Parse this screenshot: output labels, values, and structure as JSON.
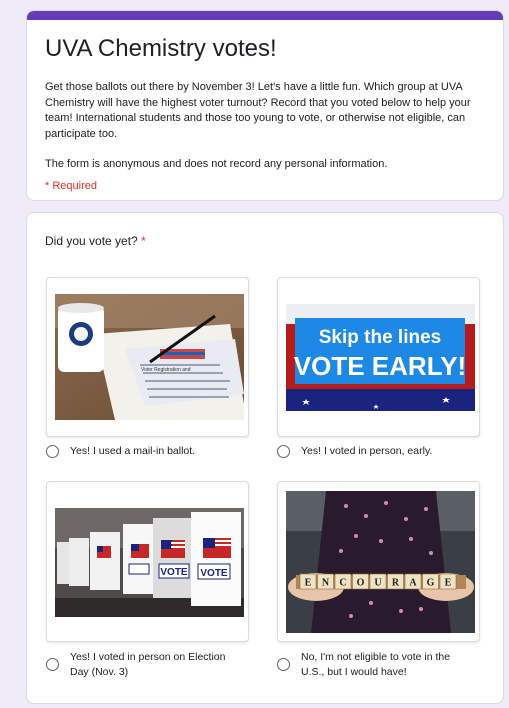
{
  "form": {
    "title": "UVA Chemistry votes!",
    "description_1": "Get those ballots out there by November 3!  Let's have a little fun.  Which group at UVA Chemistry will have the highest voter turnout?  Record that you voted below to help your team!  International students and those too young to vote, or otherwise not eligible, can participate too.",
    "description_2": "The form is anonymous and does not record any personal information.",
    "required_note": "* Required",
    "accent_color": "#673ab7",
    "background_color": "#f0ebf8",
    "required_color": "#d93025"
  },
  "question": {
    "title": "Did you vote yet?",
    "required_star": "*",
    "options": [
      {
        "label": "Yes! I used a mail-in ballot.",
        "image": "mail-in-ballot-photo"
      },
      {
        "label": "Yes! I voted in person, early.",
        "image": "vote-early-sign-photo"
      },
      {
        "label": "Yes! I voted in person on Election Day (Nov. 3)",
        "image": "voting-booths-photo"
      },
      {
        "label": "No, I'm not eligible to vote in the U.S., but I would have!",
        "image": "encourage-tiles-photo"
      }
    ]
  },
  "images": {
    "ballot_form_header": "Voter Registration and Absentee Ballot Request",
    "vote_early_line1": "Skip the lines",
    "vote_early_line2": "VOTE EARLY!",
    "booth_text": "VOTE",
    "tiles_word": [
      "E",
      "N",
      "C",
      "O",
      "U",
      "R",
      "A",
      "G",
      "E"
    ]
  }
}
